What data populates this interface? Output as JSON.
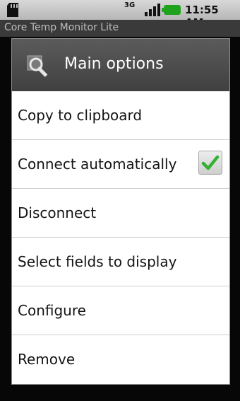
{
  "status_bar": {
    "network_label": "3G",
    "time": "11:55 AM",
    "icons": [
      "sd-card-icon",
      "network-3g-icon",
      "signal-icon",
      "battery-icon"
    ]
  },
  "app": {
    "title": "Core Temp Monitor Lite"
  },
  "dialog": {
    "title": "Main options",
    "icon": "tools-icon",
    "items": [
      {
        "label": "Copy to clipboard"
      },
      {
        "label": "Connect automatically",
        "checked": true
      },
      {
        "label": "Disconnect"
      },
      {
        "label": "Select fields to display"
      },
      {
        "label": "Configure"
      },
      {
        "label": "Remove"
      }
    ]
  },
  "colors": {
    "checkmark": "#34b234",
    "dialog_header": "#4a4a4a",
    "battery": "#1fa31f"
  }
}
